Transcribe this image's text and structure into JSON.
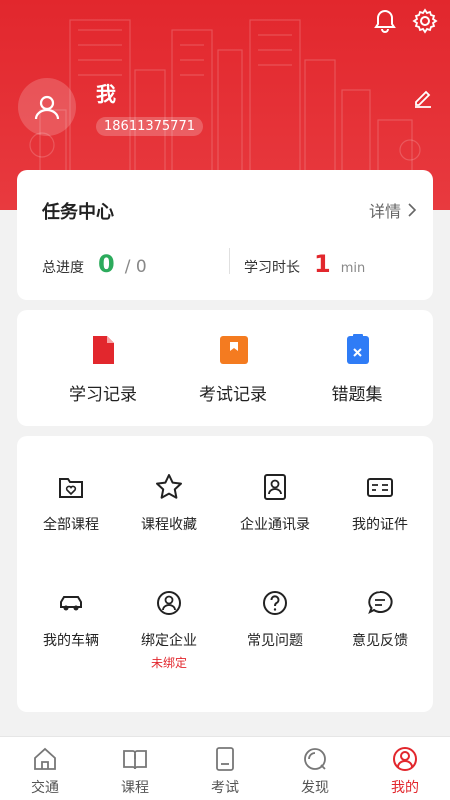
{
  "header": {
    "username": "我",
    "phone": "18611375771"
  },
  "task_center": {
    "title": "任务中心",
    "detail_label": "详情",
    "progress_label": "总进度",
    "progress_done": "0",
    "progress_total": "/ 0",
    "study_time_label": "学习时长",
    "study_time_value": "1",
    "study_time_unit": "min"
  },
  "records": [
    {
      "label": "学习记录",
      "icon": "document-icon",
      "color": "#e2272d"
    },
    {
      "label": "考试记录",
      "icon": "exam-book-icon",
      "color": "#f47b20"
    },
    {
      "label": "错题集",
      "icon": "wrong-answers-icon",
      "color": "#2f7cf6"
    }
  ],
  "services": [
    {
      "label": "全部课程",
      "icon": "folder-heart-icon"
    },
    {
      "label": "课程收藏",
      "icon": "star-icon"
    },
    {
      "label": "企业通讯录",
      "icon": "contact-card-icon"
    },
    {
      "label": "我的证件",
      "icon": "id-card-icon"
    },
    {
      "label": "我的车辆",
      "icon": "car-icon"
    },
    {
      "label": "绑定企业",
      "icon": "user-circle-icon",
      "sub": "未绑定"
    },
    {
      "label": "常见问题",
      "icon": "question-icon"
    },
    {
      "label": "意见反馈",
      "icon": "feedback-icon"
    }
  ],
  "tabs": [
    {
      "label": "交通",
      "icon": "home-icon"
    },
    {
      "label": "课程",
      "icon": "book-icon"
    },
    {
      "label": "考试",
      "icon": "exam-icon"
    },
    {
      "label": "发现",
      "icon": "discover-icon"
    },
    {
      "label": "我的",
      "icon": "profile-icon",
      "active": true
    }
  ],
  "colors": {
    "brand_red": "#e2272d",
    "green": "#2cab5c"
  }
}
